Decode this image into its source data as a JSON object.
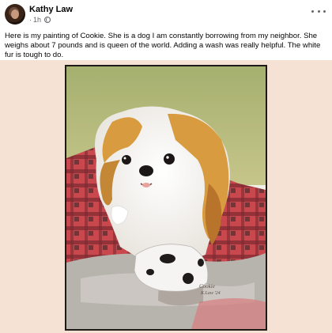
{
  "post": {
    "author": "Kathy Law",
    "time": "1h",
    "separator": "·",
    "privacy_icon": "globe-icon",
    "text": "Here is my painting of Cookie. She is a dog I am constantly borrowing from my neighbor. She weighs about 7 pounds and is queen of the world. Adding a wash was really helpful. The white fur is tough to do.",
    "signature": "Cookie",
    "signature_line2": "K.Law '24"
  },
  "colors": {
    "meta_gray": "#65676b",
    "photo_background": "#f5e2d4"
  }
}
